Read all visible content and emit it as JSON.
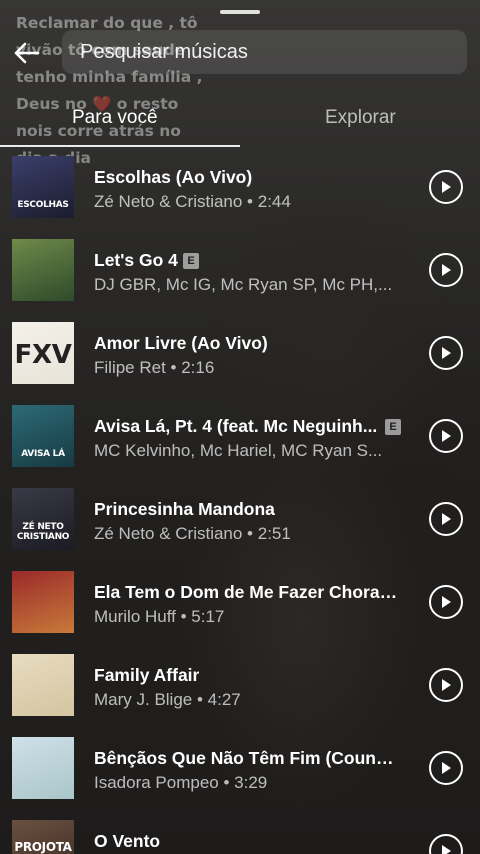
{
  "background_caption": "Reclamar do que , tô\nvivão tô com saude\ntenho minha família ,\nDeus no ❤️ o resto\nnois corre atrás no\ndia a dia",
  "search": {
    "placeholder": "Pesquisar músicas"
  },
  "tabs": [
    {
      "label": "Para você",
      "active": true
    },
    {
      "label": "Explorar",
      "active": false
    }
  ],
  "explicit_badge": "E",
  "songs": [
    {
      "title": "Escolhas (Ao Vivo)",
      "subtitle": "Zé Neto & Cristiano • 2:44",
      "cover_text": "ESCOLHAS",
      "explicit": false,
      "cover_colors": [
        "#3b3f6b",
        "#1c1c2e"
      ]
    },
    {
      "title": "Let's Go 4",
      "subtitle": "DJ GBR, Mc IG, Mc Ryan SP, Mc PH,...",
      "cover_text": "",
      "explicit": true,
      "cover_colors": [
        "#6f8a4a",
        "#2f4a2a"
      ]
    },
    {
      "title": "Amor Livre (Ao Vivo)",
      "subtitle": "Filipe Ret • 2:16",
      "cover_text": "FXV",
      "explicit": false,
      "cover_colors": [
        "#f4f1ea",
        "#e8e3d8"
      ]
    },
    {
      "title": "Avisa Lá, Pt. 4 (feat. Mc Neguinh...",
      "subtitle": "MC Kelvinho, Mc Hariel, MC Ryan S...",
      "cover_text": "AVISA LÁ",
      "explicit": true,
      "cover_colors": [
        "#2d6a74",
        "#173a44"
      ]
    },
    {
      "title": "Princesinha Mandona",
      "subtitle": "Zé Neto & Cristiano • 2:51",
      "cover_text": "ZÉ NETO CRISTIANO",
      "explicit": false,
      "cover_colors": [
        "#3a3a46",
        "#1b1b24"
      ]
    },
    {
      "title": "Ela Tem o Dom de Me Fazer Chorar...",
      "subtitle": "Murilo Huff • 5:17",
      "cover_text": "",
      "explicit": false,
      "cover_colors": [
        "#9a2a2a",
        "#c87a3a"
      ]
    },
    {
      "title": "Family Affair",
      "subtitle": "Mary J. Blige • 4:27",
      "cover_text": "",
      "explicit": false,
      "cover_colors": [
        "#e8dcc0",
        "#d4c4a0"
      ]
    },
    {
      "title": "Bênçãos Que Não Têm Fim (Counti...",
      "subtitle": "Isadora Pompeo • 3:29",
      "cover_text": "",
      "explicit": false,
      "cover_colors": [
        "#cfe0e8",
        "#a9c6c9"
      ]
    },
    {
      "title": "O Vento",
      "subtitle": "",
      "cover_text": "PROJOTA",
      "explicit": false,
      "cover_colors": [
        "#6a5040",
        "#3a2a22"
      ]
    }
  ],
  "colors": {
    "text_primary": "#ffffff",
    "text_secondary": "#b8b6b4",
    "background": "#363432"
  }
}
